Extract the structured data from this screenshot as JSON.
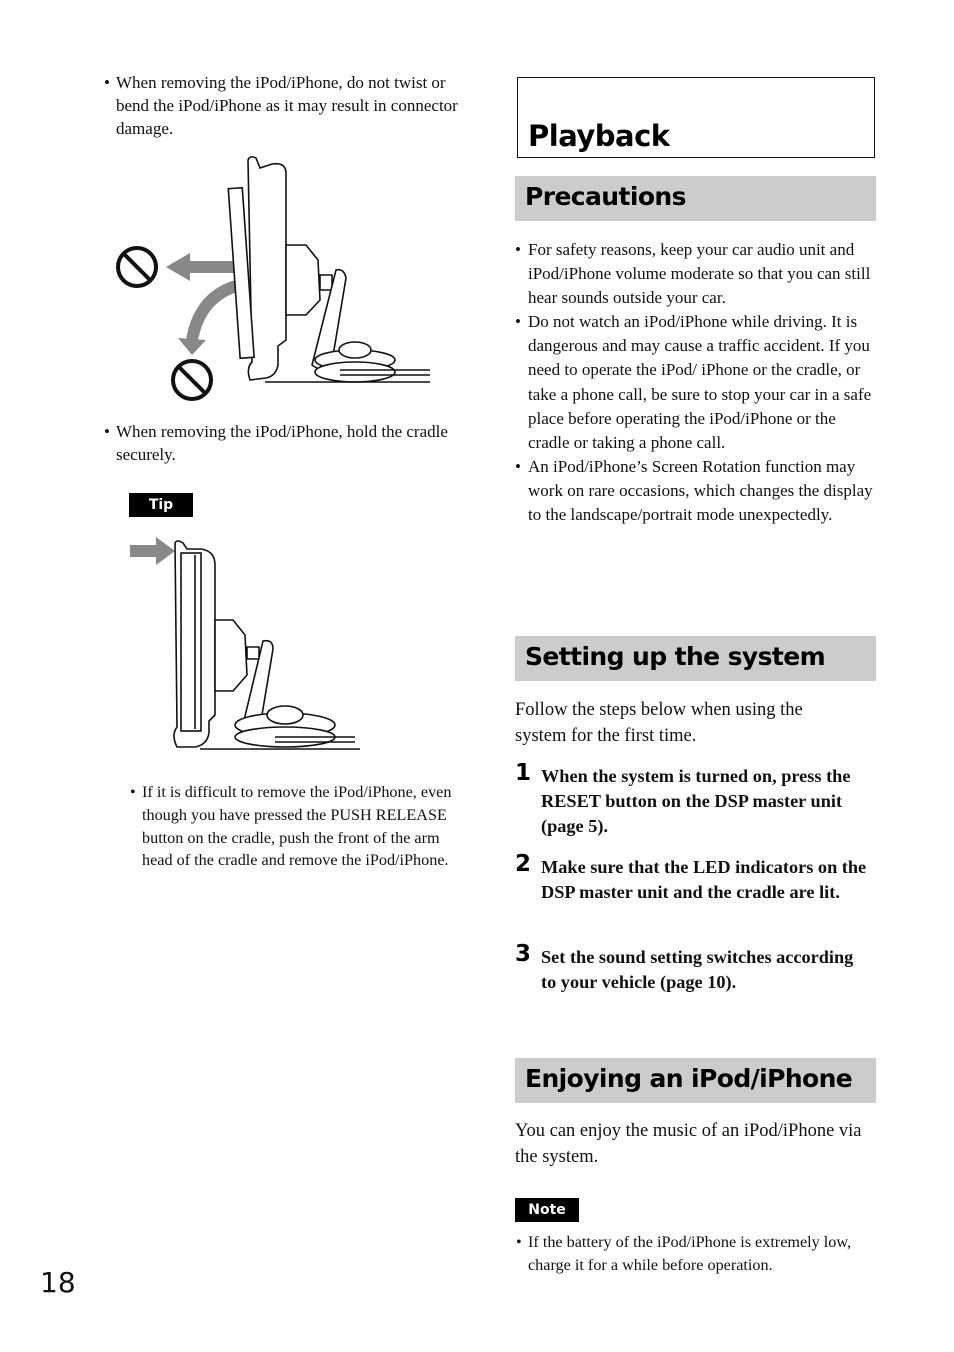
{
  "page_number": "18",
  "left_column": {
    "bullet_twist": "When removing the iPod/iPhone, do not twist or bend the iPod/iPhone as it may result in connector damage.",
    "bullet_hold": "When removing the iPod/iPhone, hold the cradle securely.",
    "tip_label": "Tip",
    "tip_bullet": "If it is difficult to remove the iPod/iPhone, even though you have pressed the PUSH RELEASE button on the cradle, push the front of the arm head of the cradle and remove the iPod/iPhone.",
    "bullet_symbol": "•"
  },
  "illustrations": {
    "figure1": {
      "description": "Cradle with iPod/iPhone; arrows showing forbidden pull and twist directions",
      "icons": [
        "prohibition-icon",
        "prohibition-icon",
        "arrow-left-icon",
        "curved-arrow-icon"
      ]
    },
    "figure2": {
      "description": "Cradle with arrow pushing the front of the arm head",
      "icons": [
        "arrow-right-icon"
      ]
    }
  },
  "right_column": {
    "chapter_title": "Playback",
    "precautions": {
      "heading": "Precautions",
      "bullets": [
        "For safety reasons, keep your car audio unit and iPod/iPhone volume moderate so that you can still hear sounds outside your car.",
        "Do not watch an iPod/iPhone while driving. It is dangerous and may cause a traffic accident. If you need to operate the iPod/ iPhone or the cradle, or take a phone call, be sure to stop your car in a safe place before operating the iPod/iPhone or the cradle or taking a phone call.",
        "An iPod/iPhone’s Screen Rotation function may work on rare occasions, which changes the display to the landscape/portrait mode unexpectedly."
      ]
    },
    "setup": {
      "heading": "Setting up the system",
      "intro": "Follow the steps below when using the system for the first time.",
      "steps": [
        {
          "num": "1",
          "text": "When the system is turned on, press the RESET button on the DSP master unit (page 5)."
        },
        {
          "num": "2",
          "text": "Make sure that the LED indicators on the DSP master unit and the cradle are lit."
        },
        {
          "num": "3",
          "text": "Set the sound setting switches according to your vehicle (page 10)."
        }
      ]
    },
    "enjoying": {
      "heading": "Enjoying an iPod/iPhone",
      "intro": "You can enjoy the music of an iPod/iPhone via the system.",
      "note_label": "Note",
      "note_bullet": "If the battery of the iPod/iPhone is extremely low, charge it for a while before operation."
    }
  }
}
